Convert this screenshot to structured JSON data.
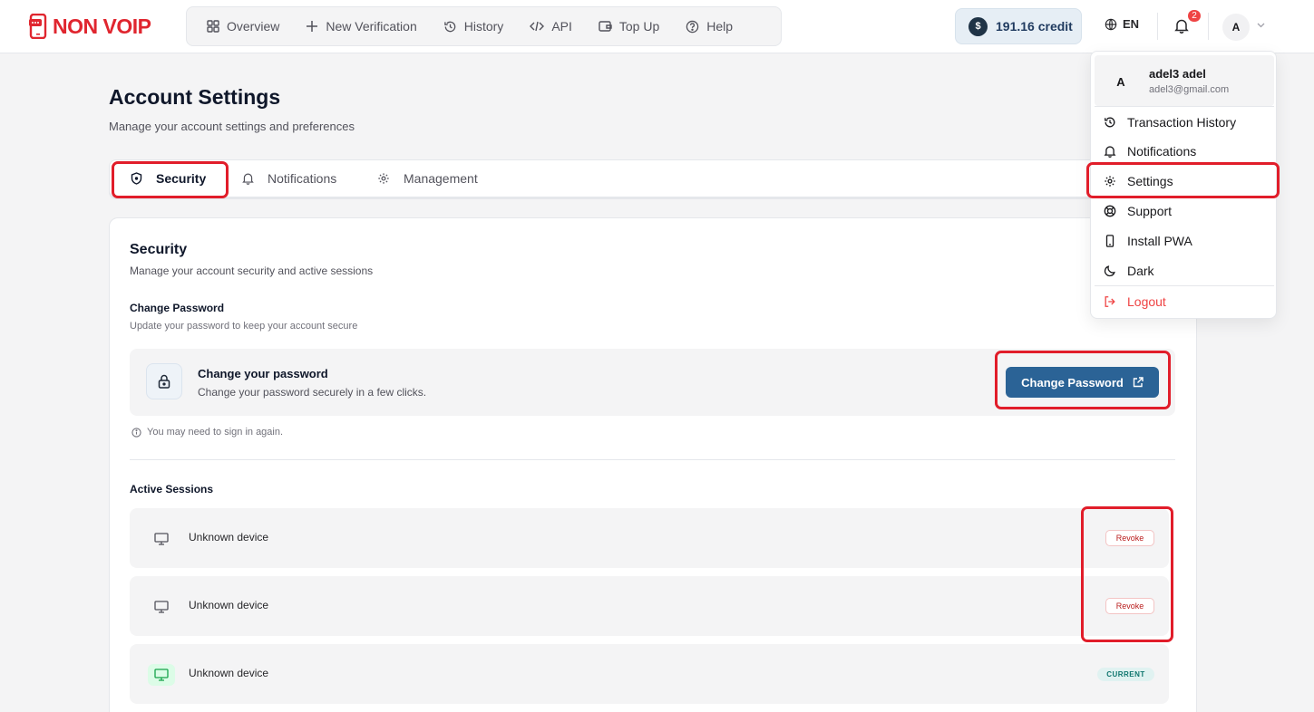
{
  "header": {
    "logo_text": "NON VOIP",
    "nav": [
      {
        "label": "Overview",
        "icon": "grid-icon"
      },
      {
        "label": "New Verification",
        "icon": "plus-icon"
      },
      {
        "label": "History",
        "icon": "history-icon"
      },
      {
        "label": "API",
        "icon": "code-icon"
      },
      {
        "label": "Top Up",
        "icon": "wallet-icon"
      },
      {
        "label": "Help",
        "icon": "help-circle-icon"
      }
    ],
    "credit_symbol": "$",
    "credit": "191.16 credit",
    "language": "EN",
    "notification_count": "2",
    "avatar_initial": "A"
  },
  "page": {
    "title": "Account Settings",
    "subtitle": "Manage your account settings and preferences"
  },
  "tabs": [
    {
      "label": "Security",
      "active": true
    },
    {
      "label": "Notifications",
      "active": false
    },
    {
      "label": "Management",
      "active": false
    }
  ],
  "security": {
    "title": "Security",
    "subtitle": "Manage your account security and active sessions",
    "change_password": {
      "title": "Change Password",
      "subtitle": "Update your password to keep your account secure",
      "box_title": "Change your password",
      "box_subtitle": "Change your password securely in a few clicks.",
      "button_label": "Change Password",
      "note": "You may need to sign in again."
    },
    "active_sessions_title": "Active Sessions",
    "sessions": [
      {
        "device": "Unknown device",
        "action": "Revoke",
        "current": false
      },
      {
        "device": "Unknown device",
        "action": "Revoke",
        "current": false
      },
      {
        "device": "Unknown device",
        "badge": "CURRENT",
        "current": true
      }
    ]
  },
  "dropdown": {
    "avatar_initial": "A",
    "name": "adel3 adel",
    "email": "adel3@gmail.com",
    "items": [
      {
        "label": "Transaction History",
        "icon": "history-icon"
      },
      {
        "label": "Notifications",
        "icon": "bell-icon"
      },
      {
        "label": "Settings",
        "icon": "gear-icon"
      },
      {
        "label": "Support",
        "icon": "lifebuoy-icon"
      },
      {
        "label": "Install PWA",
        "icon": "smartphone-icon"
      },
      {
        "label": "Dark",
        "icon": "moon-icon"
      }
    ],
    "logout_label": "Logout"
  },
  "colors": {
    "brand_red": "#e0262f",
    "primary_button": "#2b6396",
    "highlight": "#e11d2a",
    "revoke_text": "#b91c1c",
    "current_badge_bg": "#e0f2f1",
    "current_device_icon": "#16a34a"
  }
}
